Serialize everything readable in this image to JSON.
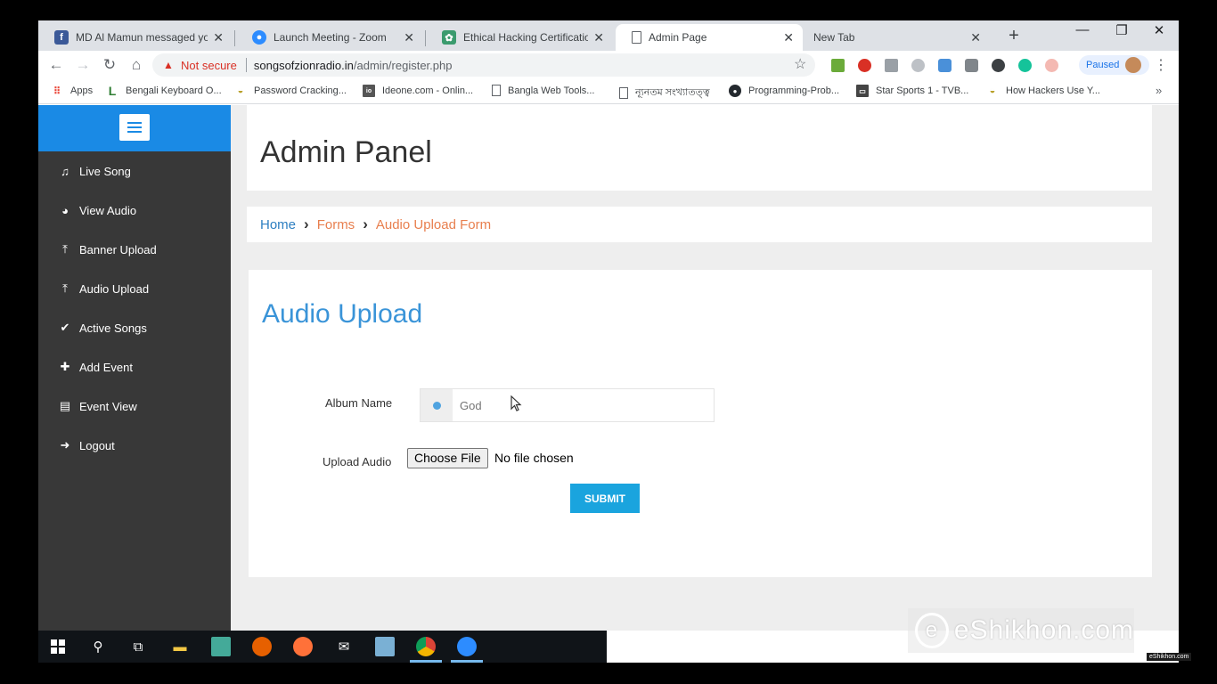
{
  "browser": {
    "tabs": [
      {
        "label": "MD Al Mamun messaged you",
        "icon": "facebook-icon",
        "color": "#3b5998"
      },
      {
        "label": "Launch Meeting - Zoom",
        "icon": "zoom-icon",
        "color": "#2d8cff"
      },
      {
        "label": "Ethical Hacking Certification Tr",
        "icon": "certificate-icon",
        "color": "#3a9b6e"
      },
      {
        "label": "Admin Page",
        "icon": "page-icon",
        "color": "#5f6368"
      },
      {
        "label": "New Tab",
        "icon": "",
        "color": ""
      }
    ],
    "window_controls": {
      "minimize": "—",
      "restore": "❐",
      "close": "✕"
    },
    "address": {
      "warning": "Not secure",
      "host": "songsofzionradio.in",
      "path": "/admin/register.php"
    },
    "profile": {
      "status": "Paused"
    },
    "bookmarks": [
      {
        "label": "Apps",
        "icon": "apps-grid-icon"
      },
      {
        "label": "Bengali Keyboard O...",
        "icon": "l-letter-icon"
      },
      {
        "label": "Password Cracking...",
        "icon": "generic-site-icon"
      },
      {
        "label": "Ideone.com - Onlin...",
        "icon": "ideone-icon"
      },
      {
        "label": "Bangla Web Tools...",
        "icon": "page-icon"
      },
      {
        "label": "ন্যূনতম সংখ্যাতত্ত্ব",
        "icon": "page-icon"
      },
      {
        "label": "Programming-Prob...",
        "icon": "github-icon"
      },
      {
        "label": "Star Sports 1 - TVB...",
        "icon": "tv-icon"
      },
      {
        "label": "How Hackers Use Y...",
        "icon": "generic-site-icon"
      }
    ]
  },
  "sidebar": {
    "items": [
      {
        "label": "Live Song",
        "icon": "music-note-icon",
        "glyph": "♫"
      },
      {
        "label": "View Audio",
        "icon": "dashboard-icon",
        "glyph": "◕"
      },
      {
        "label": "Banner Upload",
        "icon": "upload-icon",
        "glyph": "⤒"
      },
      {
        "label": "Audio Upload",
        "icon": "upload-icon",
        "glyph": "⤒"
      },
      {
        "label": "Active Songs",
        "icon": "check-icon",
        "glyph": "✔"
      },
      {
        "label": "Add Event",
        "icon": "plus-icon",
        "glyph": "✚"
      },
      {
        "label": "Event View",
        "icon": "list-icon",
        "glyph": "▤"
      },
      {
        "label": "Logout",
        "icon": "logout-icon",
        "glyph": "➜"
      }
    ]
  },
  "header": {
    "title": "Admin Panel"
  },
  "breadcrumb": {
    "home": "Home",
    "forms": "Forms",
    "current": "Audio Upload Form"
  },
  "form": {
    "title": "Audio Upload",
    "album_label": "Album Name",
    "album_placeholder": "God",
    "upload_label": "Upload Audio",
    "choose_file": "Choose File",
    "no_file": "No file chosen",
    "submit": "SUBMIT"
  },
  "watermark": {
    "text": "eShikhon.com",
    "small": "eShikhon.com"
  },
  "colors": {
    "sidebar_bg": "#383838",
    "sidebar_top": "#1a8ae5",
    "title_blue": "#3a94d8",
    "submit_blue": "#1aa4de",
    "breadcrumb_orange": "#e87f4e"
  }
}
